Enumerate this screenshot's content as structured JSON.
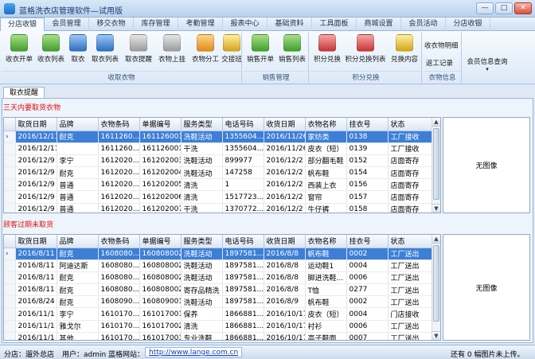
{
  "window": {
    "title": "蓝格洗衣店管理软件—试用版"
  },
  "tabs": [
    "分店收银",
    "会员管理",
    "移交衣物",
    "库存管理",
    "考勤管理",
    "报表中心",
    "基础资料",
    "工具面板",
    "商城设置",
    "会员活动",
    "分店收银"
  ],
  "ribbon": {
    "groups": {
      "receive": "收取衣物",
      "sales": "销售管理",
      "points": "积分兑换",
      "clothes_info": "衣物信息"
    },
    "buttons": {
      "receive_order": "收衣开单",
      "receive_list": "收衣列表",
      "pickup": "取衣",
      "pickup_list": "取衣列表",
      "pickup_remind": "取衣提醒",
      "clothes_hang": "衣物上挂",
      "clothes_assign": "衣物分工",
      "handover": "交接班",
      "sales_order": "销售开单",
      "sales_list": "销售列表",
      "points_exchange": "积分兑换",
      "points_exchange_list": "积分兑换列表",
      "exchange_content": "兑换内容",
      "clothes_detail": "收衣物明细",
      "rework_record": "返工记录",
      "member_info_query": "会员信息查询"
    }
  },
  "section_tab": "取衣提醒",
  "section1": {
    "title": "三天内要取货衣物",
    "columns": [
      "取货日期",
      "品牌",
      "衣物条码",
      "单据编号",
      "服务类型",
      "电话号码",
      "收货日期",
      "衣物名称",
      "挂衣号",
      "状态"
    ],
    "rows": [
      [
        "2016/12/11",
        "耐克",
        "1611260...",
        "161126001",
        "洗鞋活动",
        "1355604...",
        "2016/11/26",
        "家纺类",
        "0138",
        "工厂接收"
      ],
      [
        "2016/12/11",
        "",
        "1611260...",
        "161126001",
        "干洗",
        "1355604...",
        "2016/11/26",
        "皮衣（短）",
        "0139",
        "工厂接收"
      ],
      [
        "2016/12/9",
        "李宁",
        "1612020...",
        "161202003",
        "洗鞋活动",
        "899977",
        "2016/12/2",
        "部分翻毛鞋",
        "0152",
        "店面寄存"
      ],
      [
        "2016/12/9",
        "耐克",
        "1612020...",
        "161202004",
        "洗鞋活动",
        "147258",
        "2016/12/2",
        "帆布鞋",
        "0154",
        "店面寄存"
      ],
      [
        "2016/12/9",
        "普通",
        "1612020...",
        "161202005",
        "清洗",
        "1",
        "2016/12/2",
        "西装上衣",
        "0156",
        "店面寄存"
      ],
      [
        "2016/12/9",
        "普通",
        "1612020...",
        "161202006",
        "清洗",
        "1517723...",
        "2016/12/2",
        "窗帘",
        "0157",
        "店面寄存"
      ],
      [
        "2016/12/9",
        "普通",
        "1612020...",
        "161202007",
        "干洗",
        "1370772...",
        "2016/12/2",
        "牛仔裤",
        "0158",
        "店面寄存"
      ]
    ],
    "no_image": "无图像"
  },
  "section2": {
    "title": "顾客过期未取货",
    "columns": [
      "取货日期",
      "品牌",
      "衣物条码",
      "单据编号",
      "服务类型",
      "电话号码",
      "收货日期",
      "衣物名称",
      "挂衣号",
      "状态"
    ],
    "rows": [
      [
        "2016/8/11",
        "耐克",
        "1608080...",
        "160808002",
        "洗鞋活动",
        "1897581...",
        "2016/8/8",
        "帆布鞋",
        "0002",
        "工厂送出"
      ],
      [
        "2016/8/11",
        "阿迪达斯",
        "1608080...",
        "160808002",
        "洗鞋活动",
        "1897581...",
        "2016/8/8",
        "运动鞋1",
        "0004",
        "工厂送出"
      ],
      [
        "2016/8/11",
        "耐克",
        "1608080...",
        "160808002",
        "洗鞋活动",
        "1897581...",
        "2016/8/8",
        "脚进洗鞋...",
        "0006",
        "工厂送出"
      ],
      [
        "2016/8/11",
        "耐克",
        "1608080...",
        "160808002",
        "寄存品精洗",
        "1897581...",
        "2016/8/8",
        "T恤",
        "0277",
        "工厂送出"
      ],
      [
        "2016/8/24",
        "耐克",
        "1608090...",
        "160809001",
        "洗鞋活动",
        "1897581...",
        "2016/8/9",
        "帆布鞋",
        "0002",
        "工厂送出"
      ],
      [
        "2016/11/1",
        "李宁",
        "1610170...",
        "161017001",
        "保养",
        "1866881...",
        "2016/10/17",
        "皮衣（短）",
        "0004",
        "门店接收"
      ],
      [
        "2016/11/1",
        "雅戈尔",
        "1610170...",
        "161017002",
        "清洗",
        "1866881...",
        "2016/10/17",
        "衬衫",
        "0006",
        "工厂送出"
      ],
      [
        "2016/11/1",
        "其他",
        "1610170...",
        "161017003",
        "专业洗鞋",
        "1866881...",
        "2016/10/17",
        "高子鞋面",
        "0007",
        "工厂送出"
      ]
    ],
    "no_image": "无图像"
  },
  "status": {
    "branch": "分店：遛外总店",
    "user": "用户：admin",
    "site_label": "蓝格网站：",
    "site_url": "http://www.lange.com.cn",
    "image_count": "还有 0 幅图片未上传。"
  }
}
